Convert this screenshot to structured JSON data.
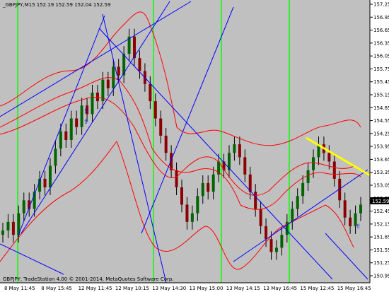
{
  "chart_title": "_GBPJPY,M15 152.19 152.59 152.04 152.59",
  "copyright": "GBPJPY, TradeStation 4.00 © 2001-2014, MetaQuotes Software Corp.",
  "current_price": "152.59",
  "colors": {
    "plot_bg": "#c0c0c0",
    "bull": "#006400",
    "bear": "#8b0000",
    "wick": "#000000",
    "band": "#ff0000",
    "trend": "#0000ff",
    "session": "#00ff00",
    "highlight": "#ffff00",
    "price_label_bg": "#000000",
    "price_label_fg": "#ffffff"
  },
  "price_axis": {
    "ticks": [
      "157.25",
      "156.95",
      "156.65",
      "156.35",
      "156.05",
      "155.75",
      "155.45",
      "155.15",
      "154.85",
      "154.55",
      "154.25",
      "153.95",
      "153.65",
      "153.35",
      "153.05",
      "152.75",
      "152.45",
      "152.15",
      "151.85",
      "151.55",
      "151.25",
      "150.95"
    ]
  },
  "time_axis": {
    "labels": [
      "8 May 11:45",
      "8 May 15:45",
      "12 May 11:45",
      "12 May 10:15",
      "13 May 14:30",
      "13 May 15:00",
      "13 May 14:15",
      "13 May 16:45",
      "15 May 12:45",
      "15 May 16:45"
    ]
  },
  "chart_data": {
    "type": "candlestick",
    "symbol": "GBPJPY",
    "timeframe": "M15",
    "ylim": [
      150.95,
      157.25
    ],
    "last": {
      "open": 152.19,
      "high": 152.59,
      "low": 152.04,
      "close": 152.59
    },
    "series": [
      {
        "values": [
          152.0,
          152.2,
          151.9,
          152.4,
          152.7,
          152.5,
          152.9,
          153.2,
          153.0,
          153.5,
          153.9,
          154.3,
          154.1,
          154.6,
          154.4,
          154.9,
          154.7,
          155.2,
          155.0,
          155.5,
          155.3,
          155.8,
          155.6,
          156.1,
          156.5,
          156.0,
          155.7,
          155.4,
          155.0,
          154.6,
          154.2,
          153.8,
          153.4,
          153.0,
          152.6,
          152.2,
          152.4,
          152.8,
          153.1,
          152.9,
          153.3,
          153.6,
          153.4,
          153.8,
          154.0,
          153.7,
          153.3,
          152.9,
          152.5,
          152.1,
          151.8,
          151.5,
          151.6,
          151.9,
          152.2,
          152.5,
          152.8,
          153.1,
          153.4,
          153.7,
          154.0,
          153.8,
          153.6,
          153.2,
          152.7,
          152.3,
          152.1,
          152.4,
          152.6
        ]
      }
    ]
  }
}
